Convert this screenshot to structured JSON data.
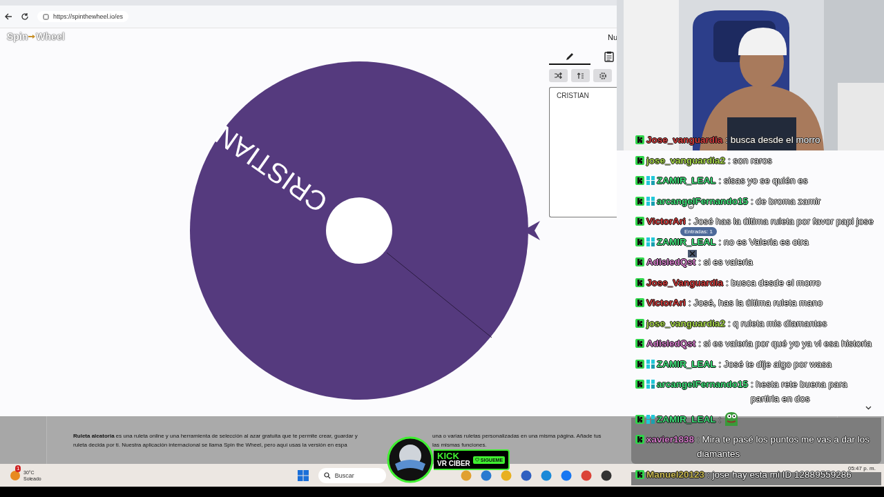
{
  "browser": {
    "url": "https://spinthewheel.io/es"
  },
  "site": {
    "logo": [
      "Spin",
      "Wheel"
    ],
    "header_text": "Nu",
    "wheel": {
      "segments": [
        {
          "label": "CRISTIAN"
        }
      ]
    },
    "tabs": [
      {
        "kind": "edit",
        "selected": true
      },
      {
        "kind": "list",
        "selected": false
      }
    ],
    "entries": "CRISTIAN",
    "tooltip": "Entradas: 1",
    "info": [
      [
        "**Ruleta aleatoria** es una ruleta online y una herramienta de selección al azar gratuita que te permite crear, guardar y",
        "una o varias ruletas personalizadas en una misma página. Añade tus"
      ],
      [
        "ruleta decida por ti. Nuestra aplicación internacional se llama Spin the Wheel, pero aquí usas la versión en espa",
        "las mismas funciones."
      ]
    ]
  },
  "kick_overlay": {
    "brand": "KICK",
    "channel": "VR CIBER",
    "follow": "SIGUEME"
  },
  "chat": [
    {
      "kind": "text",
      "user": "Jose_vanguardia",
      "color": "#d03a3a",
      "badge": false,
      "text": ": busca desde el morro"
    },
    {
      "kind": "text",
      "user": "jose_vanguardia2",
      "color": "#a8d84a",
      "badge": false,
      "text": ": son raros"
    },
    {
      "kind": "text",
      "user": "ZAMIR_LEAL",
      "color": "#3fe07a",
      "badge": true,
      "text": ": sisas yo se quién es"
    },
    {
      "kind": "text",
      "user": "arcangelFernando15",
      "color": "#3fe07a",
      "badge": true,
      "text": ": de broma zamir"
    },
    {
      "kind": "text",
      "user": "VictorAri",
      "color": "#d03a3a",
      "badge": false,
      "text": ": José has la última ruleta por favor papi jose"
    },
    {
      "kind": "text",
      "user": "ZAMIR_LEAL",
      "color": "#3fe07a",
      "badge": true,
      "text": ": no es Valeria es otra"
    },
    {
      "kind": "text",
      "user": "AdisledQst",
      "color": "#d27ac8",
      "badge": false,
      "text": ": si es valeria"
    },
    {
      "kind": "text",
      "user": "Jose_Vanguardia",
      "color": "#d03a3a",
      "badge": false,
      "text": ": busca desde el morro"
    },
    {
      "kind": "text",
      "user": "VictorAri",
      "color": "#d03a3a",
      "badge": false,
      "text": ": José, has la última ruleta mano"
    },
    {
      "kind": "text",
      "user": "jose_vanguardia2",
      "color": "#a8d84a",
      "badge": false,
      "text": ": q ruleta mis diamantes"
    },
    {
      "kind": "text",
      "user": "AdisledQst",
      "color": "#d27ac8",
      "badge": false,
      "text": ": si es valeria por qué yo ya vi esa historia"
    },
    {
      "kind": "text",
      "user": "ZAMIR_LEAL",
      "color": "#3fe07a",
      "badge": true,
      "text": ": José te dije algo por wasa"
    },
    {
      "kind": "text",
      "user": "arcangelFernando15",
      "color": "#3fe07a",
      "badge": true,
      "text": ": hesta rete buena para partirla en dos"
    },
    {
      "kind": "emote",
      "user": "ZAMIR_LEAL",
      "color": "#3fe07a",
      "badge": true,
      "text": ":"
    },
    {
      "kind": "text",
      "user": "xavier1838",
      "color": "#d27ac8",
      "badge": false,
      "text": ": Mira te pasé los puntos me vas a dar los diamantes"
    },
    {
      "kind": "text",
      "user": "Manuel20123",
      "color": "#c8b850",
      "badge": false,
      "text": ": jose hay esta mi ID 12889559286"
    }
  ],
  "taskbar": {
    "weather": {
      "badge": "1",
      "temp": "30°C",
      "condition": "Soleado"
    },
    "search_placeholder": "Buscar",
    "time": "05:47 p. m."
  }
}
